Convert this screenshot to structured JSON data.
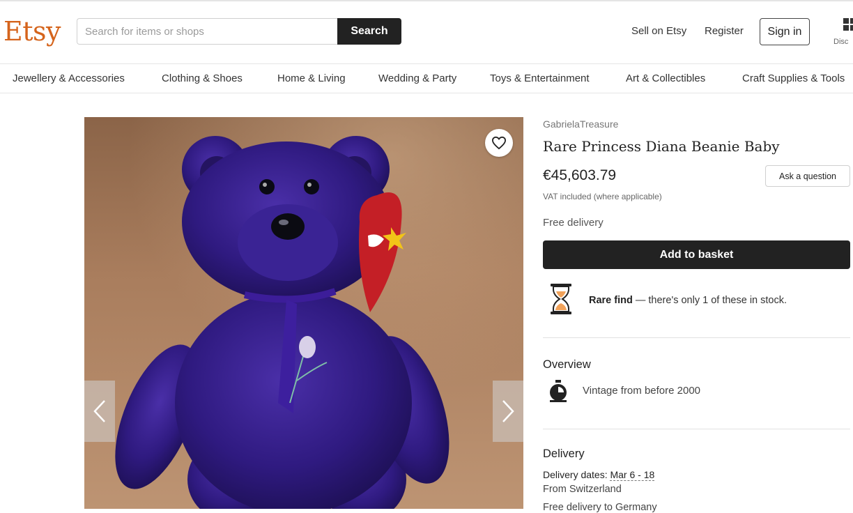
{
  "header": {
    "logo": "Etsy",
    "search_placeholder": "Search for items or shops",
    "search_button": "Search",
    "sell_link": "Sell on Etsy",
    "register_link": "Register",
    "signin_button": "Sign in",
    "discover_label": "Disc"
  },
  "categories": [
    "Jewellery & Accessories",
    "Clothing & Shoes",
    "Home & Living",
    "Wedding & Party",
    "Toys & Entertainment",
    "Art & Collectibles",
    "Craft Supplies & Tools"
  ],
  "listing": {
    "shop_name": "GabrielaTreasure",
    "title": "Rare Princess Diana Beanie Baby",
    "price": "€45,603.79",
    "ask_button": "Ask a question",
    "vat_note": "VAT included (where applicable)",
    "free_delivery": "Free delivery",
    "add_to_basket": "Add to basket",
    "rare_find_bold": "Rare find",
    "rare_find_text": " — there's only 1 of these in stock."
  },
  "overview": {
    "heading": "Overview",
    "item": "Vintage from before 2000"
  },
  "delivery": {
    "heading": "Delivery",
    "dates_label": "Delivery dates: ",
    "dates_value": "Mar 6 - 18",
    "from": "From Switzerland",
    "free_to": "Free delivery to Germany"
  },
  "colors": {
    "brand": "#d5641c",
    "button_dark": "#222222",
    "bear": "#2e1a7a"
  },
  "icons": [
    "heart-icon",
    "chevron-left-icon",
    "chevron-right-icon",
    "hourglass-icon",
    "stopwatch-icon",
    "grid-icon"
  ]
}
